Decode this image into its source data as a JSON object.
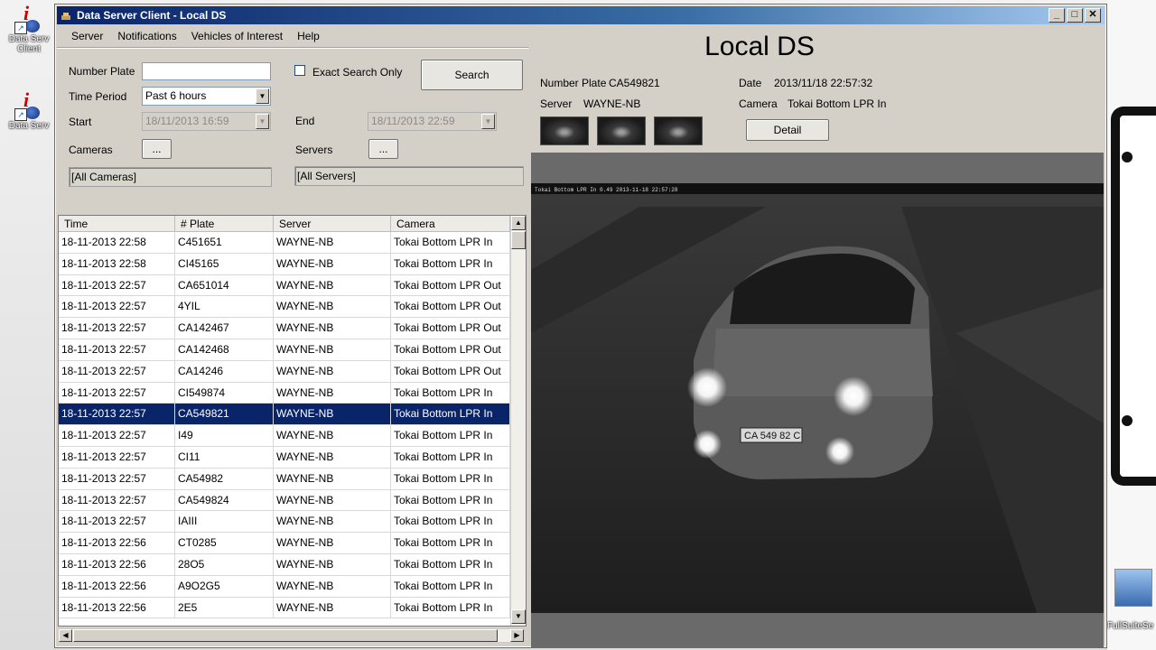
{
  "desktop": {
    "icons": [
      {
        "label": "Data Serv Client"
      },
      {
        "label": "Data Serv"
      }
    ],
    "setup_label": "FullSuiteSe"
  },
  "window": {
    "title": "Data Server Client - Local DS",
    "controls": {
      "minimize": "_",
      "maximize": "□",
      "close": "✕"
    }
  },
  "menu": [
    "Server",
    "Notifications",
    "Vehicles of Interest",
    "Help"
  ],
  "search": {
    "number_plate_label": "Number Plate",
    "number_plate_value": "",
    "exact_label": "Exact Search Only",
    "search_button": "Search",
    "time_period_label": "Time Period",
    "time_period_value": "Past 6 hours",
    "start_label": "Start",
    "start_value": "18/11/2013 16:59",
    "end_label": "End",
    "end_value": "18/11/2013 22:59",
    "cameras_label": "Cameras",
    "cameras_button": "...",
    "cameras_value": "[All Cameras]",
    "servers_label": "Servers",
    "servers_button": "...",
    "servers_value": "[All Servers]"
  },
  "table": {
    "columns": [
      "Time",
      "# Plate",
      "Server",
      "Camera"
    ],
    "rows": [
      [
        "18-11-2013 22:58",
        "C451651",
        "WAYNE-NB",
        "Tokai Bottom LPR In"
      ],
      [
        "18-11-2013 22:58",
        "CI45165",
        "WAYNE-NB",
        "Tokai Bottom LPR In"
      ],
      [
        "18-11-2013 22:57",
        "CA651014",
        "WAYNE-NB",
        "Tokai Bottom LPR Out"
      ],
      [
        "18-11-2013 22:57",
        "4YIL",
        "WAYNE-NB",
        "Tokai Bottom LPR Out"
      ],
      [
        "18-11-2013 22:57",
        "CA142467",
        "WAYNE-NB",
        "Tokai Bottom LPR Out"
      ],
      [
        "18-11-2013 22:57",
        "CA142468",
        "WAYNE-NB",
        "Tokai Bottom LPR Out"
      ],
      [
        "18-11-2013 22:57",
        "CA14246",
        "WAYNE-NB",
        "Tokai Bottom LPR Out"
      ],
      [
        "18-11-2013 22:57",
        "CI549874",
        "WAYNE-NB",
        "Tokai Bottom LPR In"
      ],
      [
        "18-11-2013 22:57",
        "CA549821",
        "WAYNE-NB",
        "Tokai Bottom LPR In"
      ],
      [
        "18-11-2013 22:57",
        "I49",
        "WAYNE-NB",
        "Tokai Bottom LPR In"
      ],
      [
        "18-11-2013 22:57",
        "CI11",
        "WAYNE-NB",
        "Tokai Bottom LPR In"
      ],
      [
        "18-11-2013 22:57",
        "CA54982",
        "WAYNE-NB",
        "Tokai Bottom LPR In"
      ],
      [
        "18-11-2013 22:57",
        "CA549824",
        "WAYNE-NB",
        "Tokai Bottom LPR In"
      ],
      [
        "18-11-2013 22:57",
        "IAIII",
        "WAYNE-NB",
        "Tokai Bottom LPR In"
      ],
      [
        "18-11-2013 22:56",
        "CT0285",
        "WAYNE-NB",
        "Tokai Bottom LPR In"
      ],
      [
        "18-11-2013 22:56",
        "28O5",
        "WAYNE-NB",
        "Tokai Bottom LPR In"
      ],
      [
        "18-11-2013 22:56",
        "A9O2G5",
        "WAYNE-NB",
        "Tokai Bottom LPR In"
      ],
      [
        "18-11-2013 22:56",
        "2E5",
        "WAYNE-NB",
        "Tokai Bottom LPR In"
      ]
    ],
    "selected_index": 8
  },
  "detail": {
    "heading": "Local DS",
    "plate_label": "Number Plate",
    "plate_value": "CA549821",
    "date_label": "Date",
    "date_value": "2013/11/18 22:57:32",
    "server_label": "Server",
    "server_value": "WAYNE-NB",
    "camera_label": "Camera",
    "camera_value": "Tokai Bottom LPR In",
    "detail_button": "Detail",
    "overlay_text": "Tokai Bottom LPR In  0.49 2013-11-18 22:57:28",
    "car_plate_text": "CA 549 82 C"
  },
  "colors": {
    "title_bar": "#0a246a",
    "selection": "#0a246a",
    "window_face": "#d4d0c8"
  }
}
